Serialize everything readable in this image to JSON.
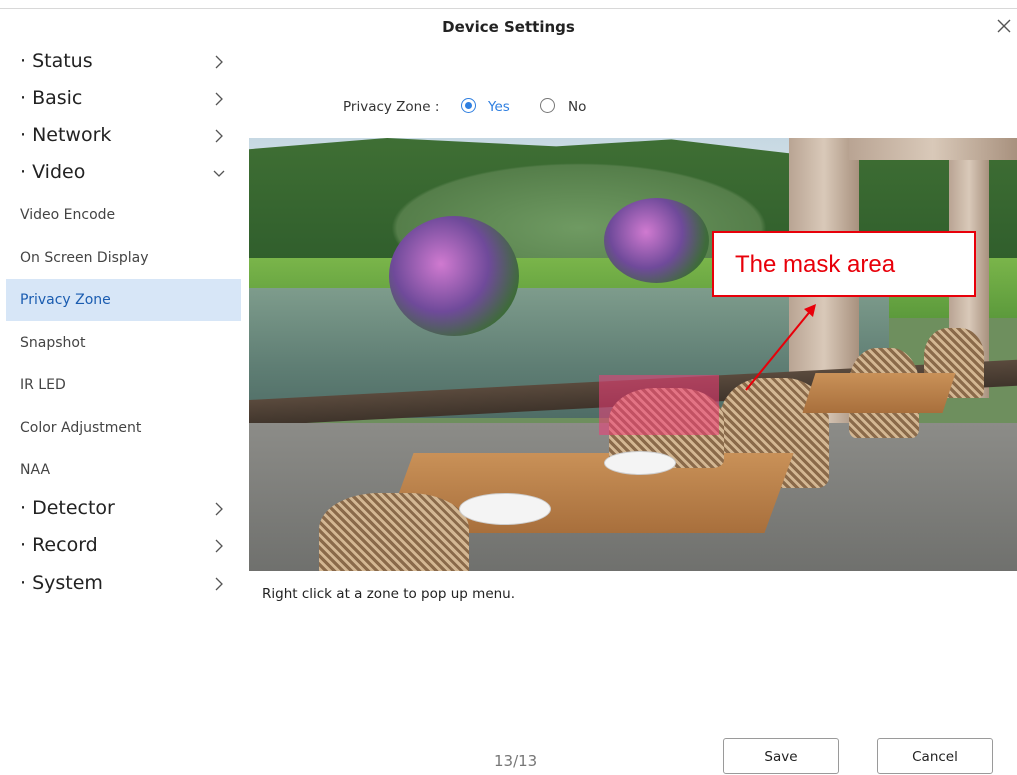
{
  "window": {
    "title": "Device Settings"
  },
  "sidebar": {
    "sections": [
      {
        "label": "· Status"
      },
      {
        "label": "· Basic"
      },
      {
        "label": "· Network"
      },
      {
        "label": "· Video"
      }
    ],
    "video_items": [
      {
        "label": "Video Encode"
      },
      {
        "label": "On Screen Display"
      },
      {
        "label": "Privacy Zone"
      },
      {
        "label": "Snapshot"
      },
      {
        "label": "IR LED"
      },
      {
        "label": "Color Adjustment"
      },
      {
        "label": "NAA"
      }
    ],
    "lower_sections": [
      {
        "label": "· Detector"
      },
      {
        "label": "· Record"
      },
      {
        "label": "· System"
      }
    ]
  },
  "privacy_zone": {
    "label": "Privacy Zone :",
    "options": [
      "Yes",
      "No"
    ],
    "selected": "Yes"
  },
  "annotation": {
    "text": "The mask area"
  },
  "hint": "Right click at a zone to pop up menu.",
  "pager": "13/13",
  "buttons": {
    "save": "Save",
    "cancel": "Cancel"
  }
}
